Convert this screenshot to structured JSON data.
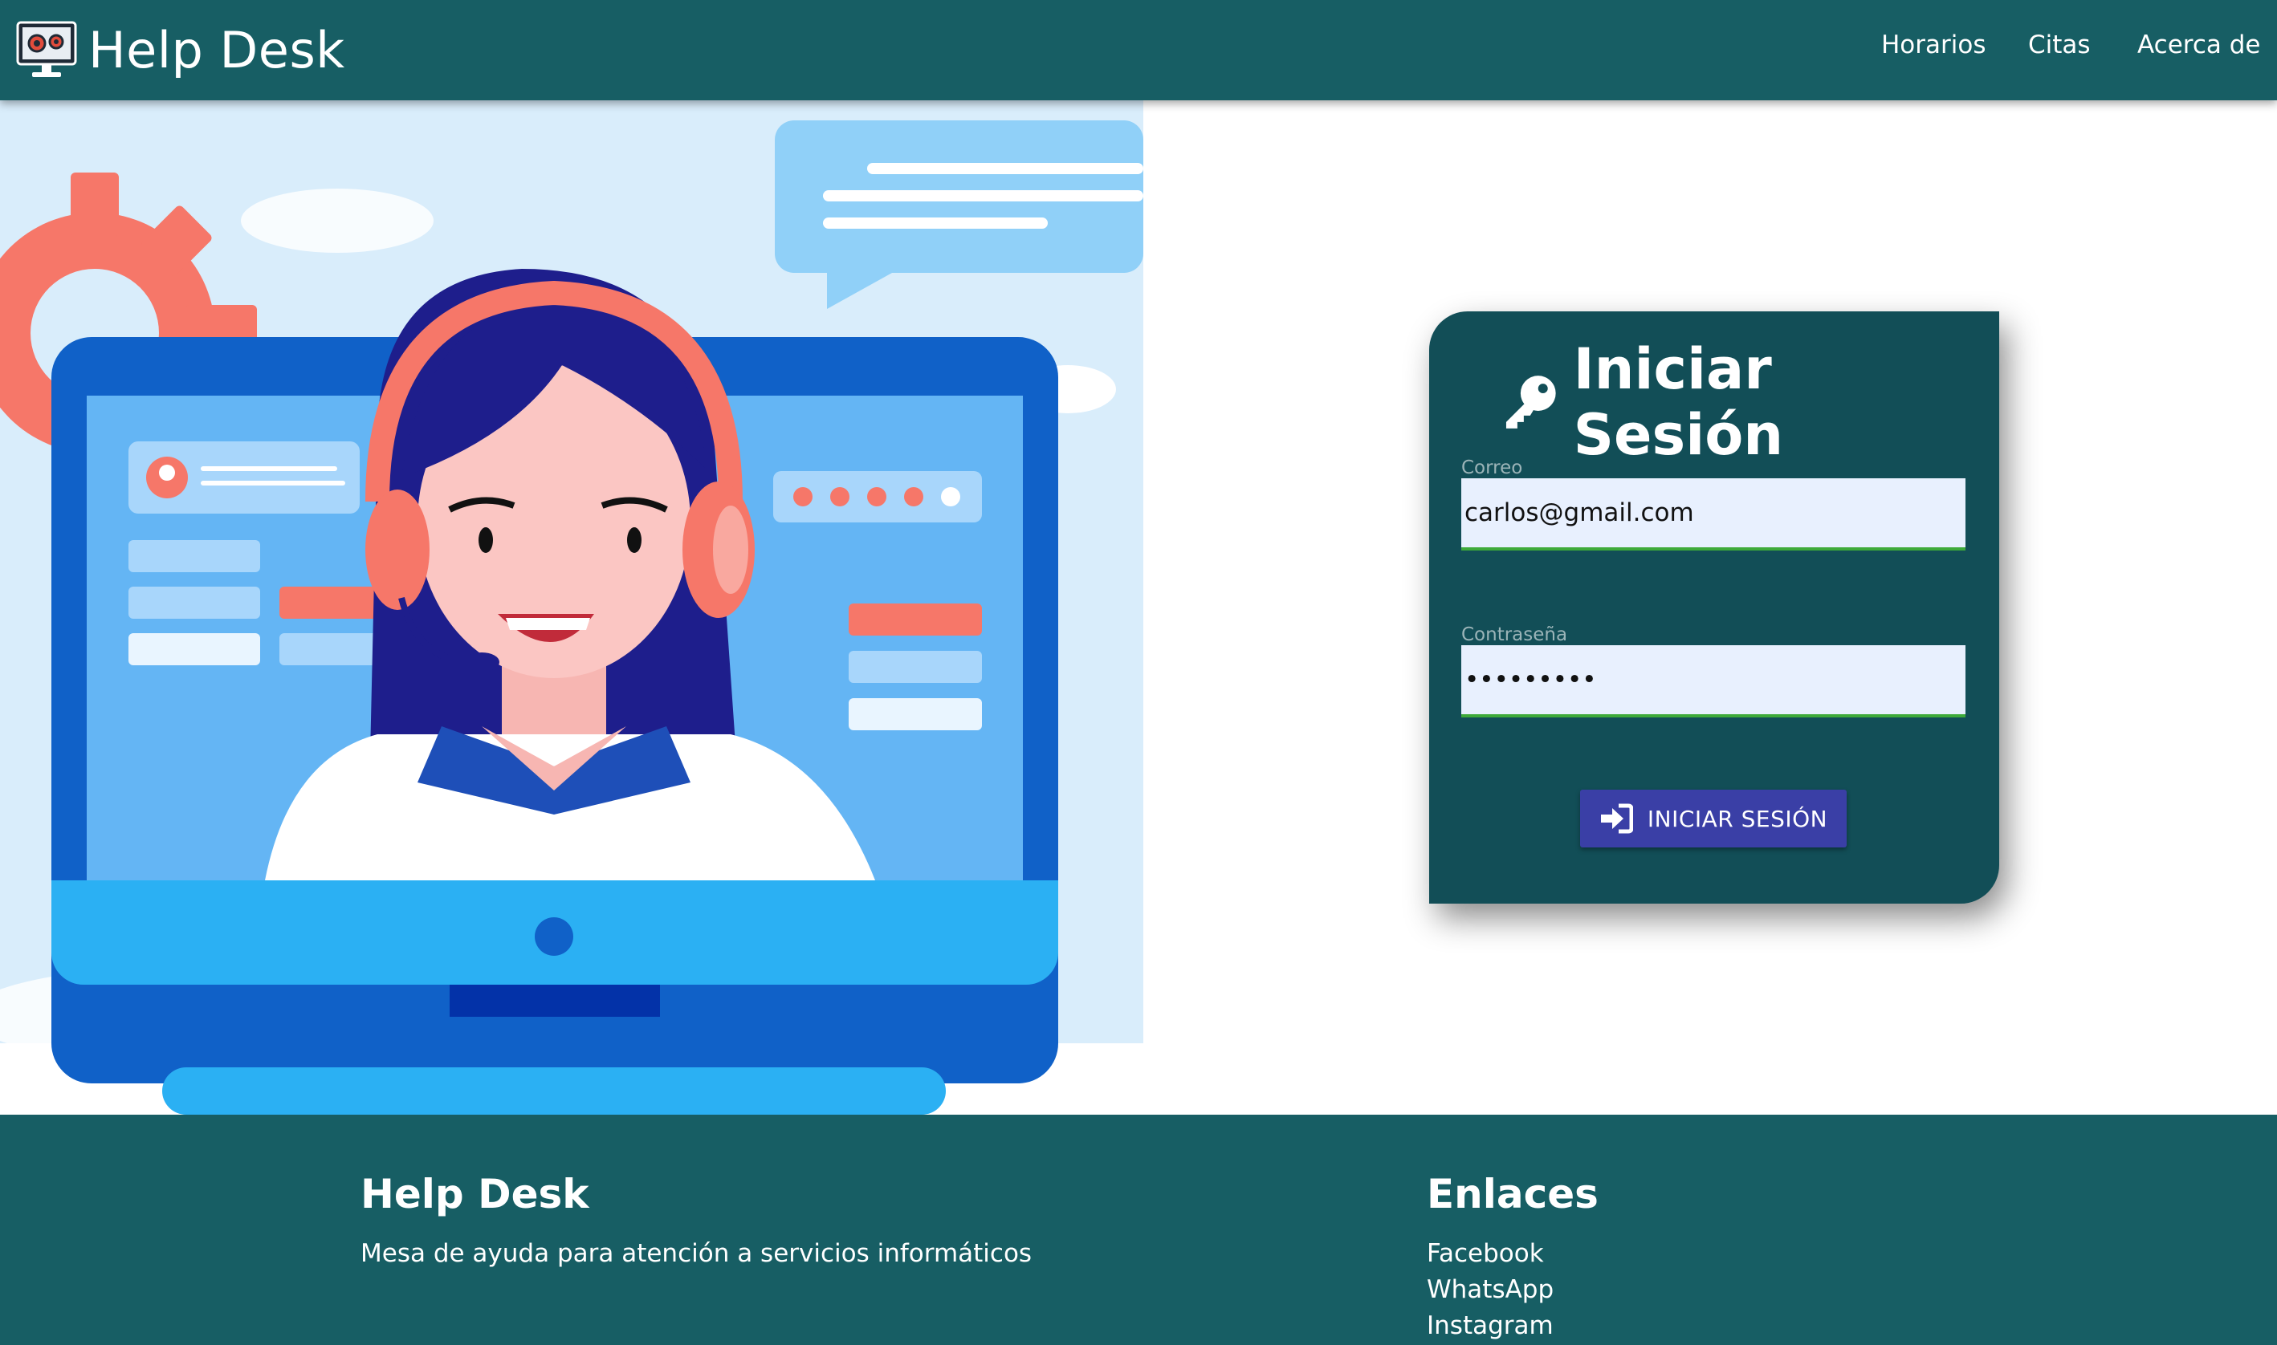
{
  "colors": {
    "primary": "#175e64",
    "card": "#124e57",
    "button": "#3a3fa6",
    "input_bg": "#e8f0fe",
    "input_underline": "#3eaa3a"
  },
  "navbar": {
    "brand": "Help Desk",
    "logo_icon": "monitor-gears-icon",
    "links": [
      "Horarios",
      "Citas",
      "Acerca de"
    ]
  },
  "hero": {
    "icon": "support-agent-illustration"
  },
  "login": {
    "title": "Iniciar Sesión",
    "title_icon": "key-icon",
    "email_label": "Correo",
    "email_value": "carlos@gmail.com",
    "password_label": "Contraseña",
    "password_value": "carlos123",
    "button_label": "INICIAR SESIÓN",
    "button_icon": "sign-in-icon"
  },
  "footer": {
    "brand_title": "Help Desk",
    "brand_text": "Mesa de ayuda para atención a servicios informáticos",
    "links_title": "Enlaces",
    "links": [
      "Facebook",
      "WhatsApp",
      "Instagram"
    ]
  }
}
